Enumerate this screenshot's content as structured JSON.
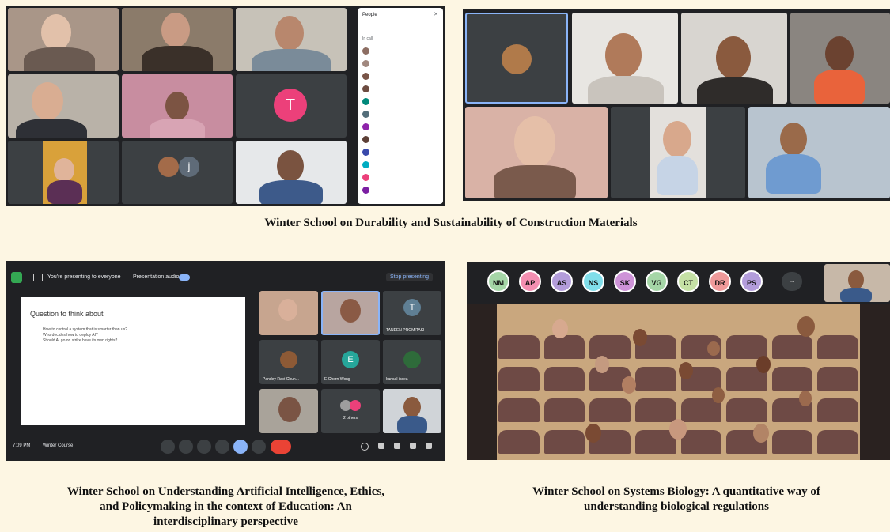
{
  "captions": {
    "construction": "Winter School on Durability and Sustainability of Construction Materials",
    "ai_line1": "Winter School on Understanding Artificial Intelligence, Ethics,",
    "ai_line2": "and Policymaking in the context of Education: An",
    "ai_line3": "interdisciplinary perspective",
    "bio_line1": "Winter School on Systems Biology: A quantitative way of",
    "bio_line2": "understanding biological regulations"
  },
  "panel1": {
    "avatar_t": "T",
    "avatar_j": "j",
    "people_title": "People",
    "people_row_count_label": "In call"
  },
  "panel3": {
    "presenting_text": "You're presenting to everyone",
    "audio_label": "Presentation audio",
    "stop_label": "Stop presenting",
    "slide_title": "Question to think about",
    "slide_bullets": [
      "How to control a system that is smarter than us?",
      "Who decides how to deploy AI?",
      "Should AI go on strike have its own rights?"
    ],
    "tile_t_letter": "T",
    "tile_t_name": "TANEEN PROMITAKI",
    "tile_e_letter": "E",
    "tile_e_name": "E Chern Wong",
    "tile_name_a": "Pandey Ravi Chun...",
    "tile_name_b": "kansal issea",
    "tile_others": "2 others",
    "time": "7:09 PM",
    "meeting": "Winter Course"
  },
  "panel4": {
    "chips": [
      "NM",
      "AP",
      "AS",
      "NS",
      "SK",
      "VG",
      "CT",
      "DR",
      "PS"
    ]
  },
  "colors": {
    "meet_dark": "#202124",
    "accent_blue": "#8ab4f8",
    "end_call_red": "#ea4335",
    "page_bg": "#fdf6e3"
  }
}
